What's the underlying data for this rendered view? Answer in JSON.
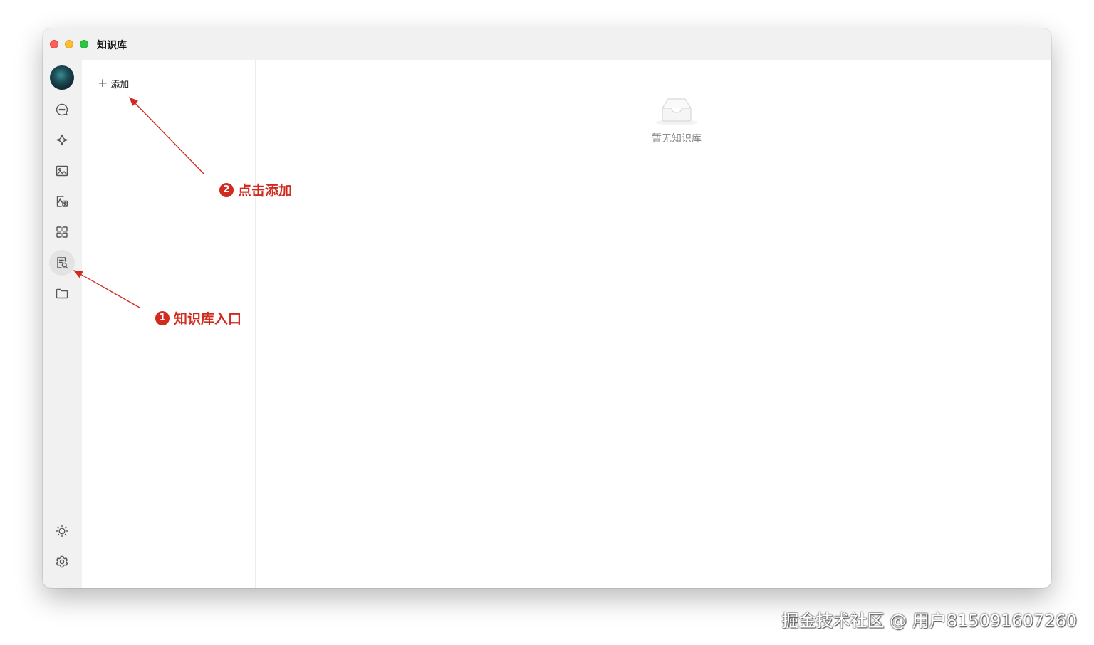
{
  "window": {
    "title": "知识库"
  },
  "sidebar": {
    "items": [
      {
        "name": "chat",
        "icon": "chat-bubble-icon"
      },
      {
        "name": "assistant",
        "icon": "sparkle-icon"
      },
      {
        "name": "image",
        "icon": "image-icon"
      },
      {
        "name": "translate",
        "icon": "translate-icon"
      },
      {
        "name": "apps",
        "icon": "grid-icon"
      },
      {
        "name": "knowledge",
        "icon": "knowledge-search-icon",
        "active": true
      },
      {
        "name": "files",
        "icon": "folder-icon"
      }
    ],
    "bottom": [
      {
        "name": "theme",
        "icon": "sun-icon"
      },
      {
        "name": "settings",
        "icon": "gear-icon"
      }
    ]
  },
  "list": {
    "add_label": "添加"
  },
  "main": {
    "empty_text": "暂无知识库"
  },
  "annotations": {
    "step1": {
      "num": "1",
      "label": "知识库入口"
    },
    "step2": {
      "num": "2",
      "label": "点击添加"
    },
    "color": "#d12a1f"
  },
  "watermark": "掘金技术社区 @ 用户815091607260"
}
